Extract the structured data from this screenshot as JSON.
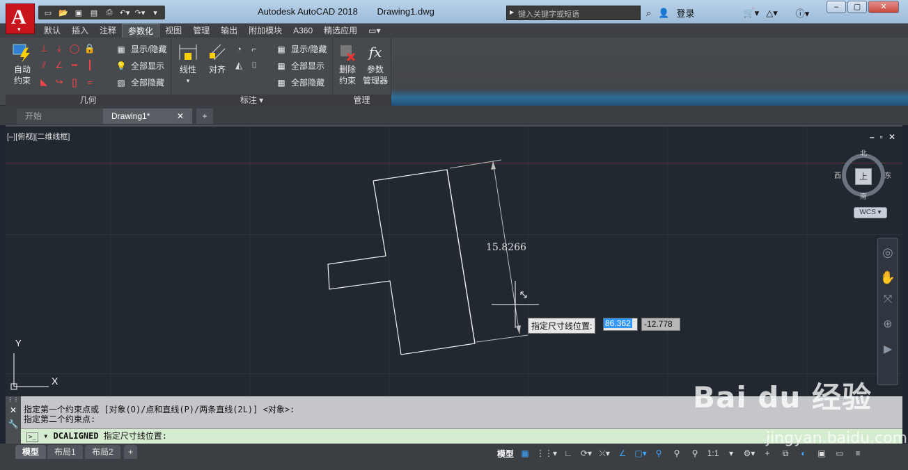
{
  "app": {
    "title": "Autodesk AutoCAD 2018",
    "document": "Drawing1.dwg",
    "logo_letter": "A"
  },
  "search": {
    "placeholder": "键入关键字或短语"
  },
  "title_tools": {
    "login": "登录"
  },
  "ribbon_tabs": [
    "默认",
    "插入",
    "注释",
    "参数化",
    "视图",
    "管理",
    "输出",
    "附加模块",
    "A360",
    "精选应用"
  ],
  "active_tab": "参数化",
  "panels": {
    "geometry": {
      "label": "几何",
      "auto_constrain": "自动\n约束",
      "show_hide": "显示/隐藏",
      "show_all": "全部显示",
      "hide_all": "全部隐藏"
    },
    "dimension": {
      "label": "标注",
      "linear": "线性",
      "aligned": "对齐",
      "show_hide": "显示/隐藏",
      "show_all": "全部显示",
      "hide_all": "全部隐藏"
    },
    "manage": {
      "label": "管理",
      "delete_constraints": "删除\n约束",
      "param_manager": "参数\n管理器"
    }
  },
  "doc_tabs": [
    {
      "label": "开始"
    },
    {
      "label": "Drawing1*"
    }
  ],
  "viewport": {
    "label": "[–][俯视][二维线框]",
    "viewcube": {
      "north": "北",
      "south": "南",
      "east": "东",
      "west": "西",
      "face": "上"
    },
    "wcs": "WCS",
    "dimension_value": "15.8266",
    "prompt_label": "指定尺寸线位置:",
    "input_x": "86.362",
    "input_y": "-12.778",
    "ucs_y": "Y",
    "ucs_x": "X"
  },
  "command": {
    "history": [
      "指定第一个约束点或 [对象(O)/点和直线(P)/两条直线(2L)] <对象>:",
      "指定第二个约束点:"
    ],
    "prompt_cmd": "DCALIGNED",
    "prompt_text": "指定尺寸线位置:"
  },
  "layout_tabs": [
    "模型",
    "布局1",
    "布局2"
  ],
  "status": {
    "model": "模型",
    "scale": "1:1"
  },
  "watermark": {
    "text": "Bai  du 经验",
    "url": "jingyan.baidu.com"
  },
  "colors": {
    "accent": "#3399ff",
    "app_red": "#c8141b",
    "canvas": "#212830"
  }
}
